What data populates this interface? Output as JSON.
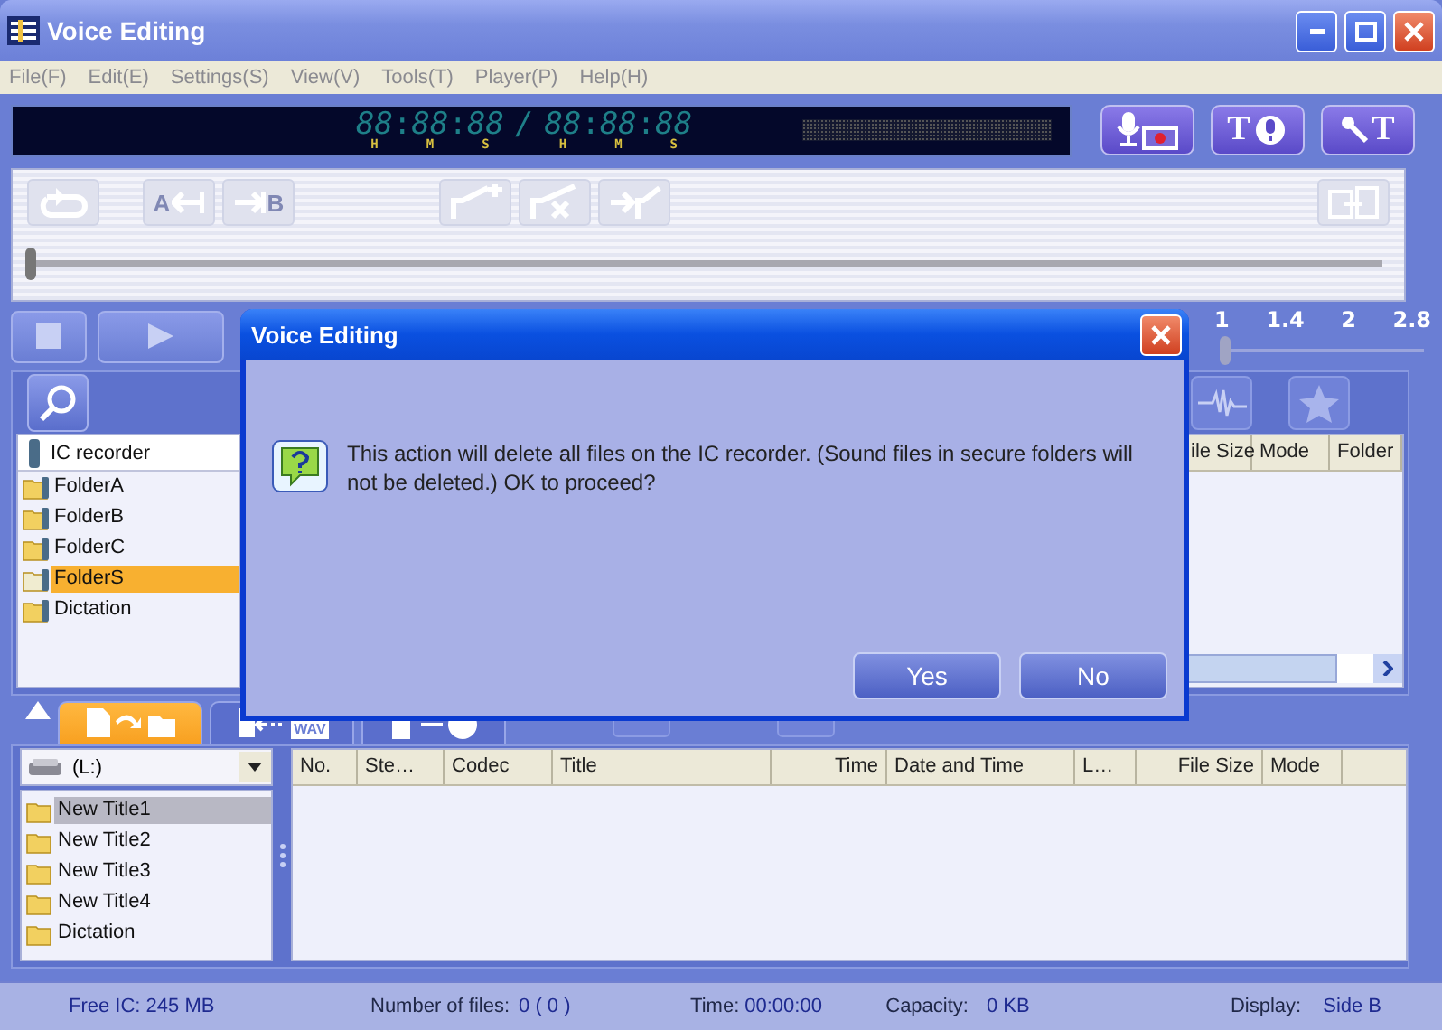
{
  "window": {
    "title": "Voice Editing"
  },
  "menu": [
    "File(F)",
    "Edit(E)",
    "Settings(S)",
    "View(V)",
    "Tools(T)",
    "Player(P)",
    "Help(H)"
  ],
  "display": {
    "segments": [
      {
        "text": "88",
        "unit": "H"
      },
      {
        "text": ":"
      },
      {
        "text": "88",
        "unit": "M"
      },
      {
        "text": ":"
      },
      {
        "text": "88",
        "unit": "S"
      },
      {
        "text": "/"
      },
      {
        "text": "88",
        "unit": "H"
      },
      {
        "text": ":"
      },
      {
        "text": "88",
        "unit": "M"
      },
      {
        "text": ":"
      },
      {
        "text": "88",
        "unit": "S"
      }
    ]
  },
  "mode_buttons": [
    {
      "kind": "record"
    },
    {
      "kind": "text-mic",
      "letter": "T"
    },
    {
      "kind": "mic-text",
      "letter": "T"
    }
  ],
  "toolbar": {
    "buttons": [
      {
        "kind": "loop",
        "disabled": true
      },
      {
        "kind": "a-point",
        "letter": "A",
        "disabled": true
      },
      {
        "kind": "b-point",
        "letter": "B",
        "disabled": true
      },
      {
        "kind": "add-mark",
        "disabled": true
      },
      {
        "kind": "delete-mark",
        "disabled": true
      },
      {
        "kind": "move-mark",
        "disabled": true
      },
      {
        "kind": "split",
        "disabled": true
      }
    ],
    "position": {
      "level": 0
    }
  },
  "transport": {
    "buttons": [
      {
        "kind": "stop"
      },
      {
        "kind": "play"
      }
    ],
    "speed_labels": [
      "1",
      "1.4",
      "2",
      "2.8"
    ],
    "speed": {
      "level": 0
    }
  },
  "ic_panel": {
    "tool_buttons": [
      {
        "kind": "waveform"
      },
      {
        "kind": "star"
      }
    ],
    "tree": {
      "label": "IC recorder",
      "children": [
        {
          "label": "FolderA",
          "selected": false
        },
        {
          "label": "FolderB",
          "selected": false
        },
        {
          "label": "FolderC",
          "selected": false
        },
        {
          "label": "FolderS",
          "selected": true
        },
        {
          "label": "Dictation",
          "selected": false
        }
      ]
    },
    "columns": [
      "ile Size",
      "Mode",
      "Folder"
    ]
  },
  "tabs": [
    {
      "kind": "to-folder",
      "selected": true
    },
    {
      "kind": "wav",
      "letter": "WAV",
      "selected": false
    },
    {
      "kind": "to-disc",
      "selected": false
    }
  ],
  "pc_panel": {
    "drive": "(L:)",
    "folders": [
      {
        "label": "New Title1",
        "selected": true
      },
      {
        "label": "New Title2",
        "selected": false
      },
      {
        "label": "New Title3",
        "selected": false
      },
      {
        "label": "New Title4",
        "selected": false
      },
      {
        "label": "Dictation",
        "selected": false
      }
    ],
    "columns": [
      "No.",
      "Ste…",
      "Codec",
      "Title",
      "Time",
      "Date and Time",
      "L…",
      "File Size",
      "Mode"
    ]
  },
  "status_bar": {
    "free": "Free IC: 245 MB",
    "files_label": "Number of files:",
    "files": "0 ( 0 )",
    "time_label": "Time:",
    "time": "00:00:00",
    "capacity_label": "Capacity:",
    "capacity": "0 KB",
    "display_label": "Display:",
    "display": "Side B"
  },
  "dialog": {
    "title": "Voice Editing",
    "message": "This action will delete all files on the IC recorder. (Sound files in secure folders will not be deleted.)  OK to proceed?",
    "buttons": [
      "Yes",
      "No"
    ]
  }
}
